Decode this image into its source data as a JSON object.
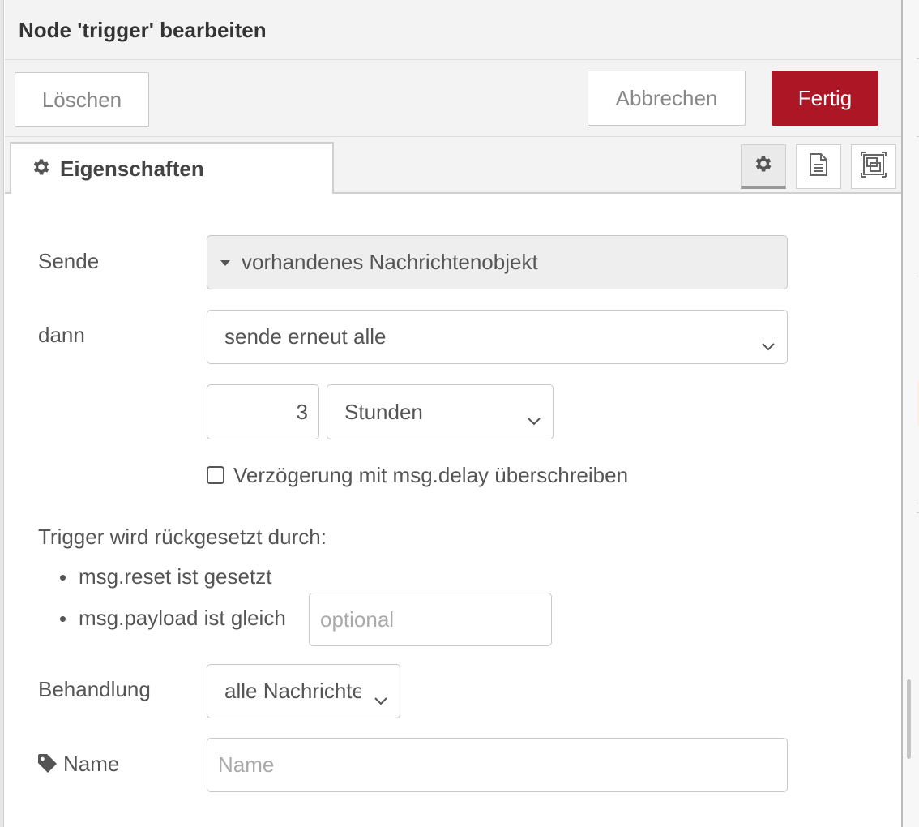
{
  "dialog": {
    "title": "Node 'trigger' bearbeiten",
    "delete_label": "Löschen",
    "cancel_label": "Abbrechen",
    "done_label": "Fertig"
  },
  "tabs": {
    "properties_label": "Eigenschaften",
    "side_buttons": [
      "gear-icon",
      "description-icon",
      "appearance-icon"
    ]
  },
  "form": {
    "send_label": "Sende",
    "send_value": "vorhandenes Nachrichtenobjekt",
    "then_label": "dann",
    "then_value": "sende erneut alle",
    "interval_value": "3",
    "interval_unit": "Stunden",
    "override_delay_label": "Verzögerung mit msg.delay überschreiben",
    "override_delay_checked": false,
    "reset_heading": "Trigger wird rückgesetzt durch:",
    "reset_items": [
      "msg.reset ist gesetzt",
      "msg.payload ist gleich"
    ],
    "reset_payload_placeholder": "optional",
    "handling_label": "Behandlung",
    "handling_value": "alle Nachrichten",
    "name_label": "Name",
    "name_placeholder": "Name"
  },
  "colors": {
    "primary": "#ad1625",
    "header_bg": "#f3f3f3",
    "disabled_field_bg": "#eeeeee"
  }
}
